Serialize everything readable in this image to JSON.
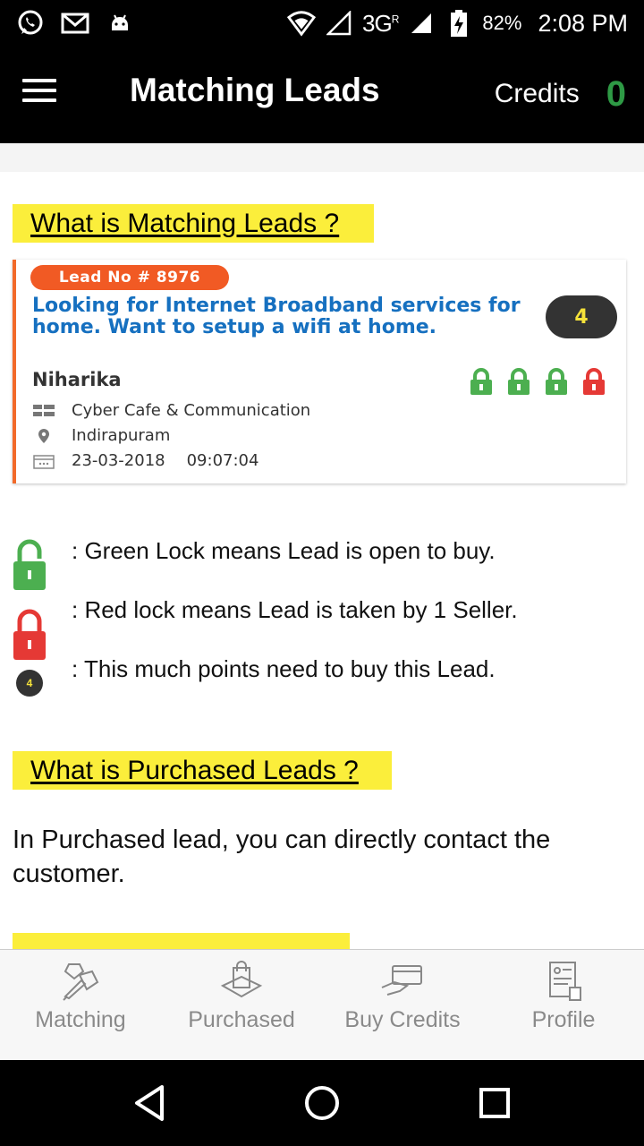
{
  "status_bar": {
    "network": "3G",
    "network_sup": "R",
    "battery": "82%",
    "time": "2:08 PM",
    "icons": [
      "whatsapp-icon",
      "gmail-icon",
      "android-icon",
      "wifi-icon",
      "signal-icon",
      "battery-charging-icon"
    ]
  },
  "app_bar": {
    "title": "Matching Leads",
    "credits_label": "Credits",
    "credits_value": "0"
  },
  "sections": {
    "matching_header": "What is Matching Leads ?",
    "purchased_header": "What is Purchased Leads ?",
    "purchased_text": "In Purchased lead, you can directly contact the customer."
  },
  "lead_card": {
    "lead_no": "Lead No # 8976",
    "title": "Looking for Internet Broadband services for home. Want to setup a wifi at home.",
    "points": "4",
    "name": "Niharika",
    "category": "Cyber Cafe & Communication",
    "location": "Indirapuram",
    "date": "23-03-2018",
    "time": "09:07:04",
    "locks": [
      "green",
      "green",
      "green",
      "red"
    ]
  },
  "legend": {
    "green_lock": ": Green Lock means Lead is open to buy.",
    "red_lock": ": Red lock means Lead is taken by 1 Seller.",
    "points": ": This much points need to buy this Lead.",
    "points_value": "4"
  },
  "bottom_nav": {
    "items": [
      {
        "label": "Matching",
        "icon": "matching-icon"
      },
      {
        "label": "Purchased",
        "icon": "shopping-bag-icon"
      },
      {
        "label": "Buy Credits",
        "icon": "card-hand-icon"
      },
      {
        "label": "Profile",
        "icon": "profile-document-icon"
      }
    ]
  },
  "colors": {
    "accent_orange": "#f15a24",
    "title_blue": "#1670c0",
    "highlight_yellow": "#fbee3b",
    "credits_green": "#2e9a45",
    "lock_green": "#4caf50",
    "lock_red": "#e53935"
  }
}
